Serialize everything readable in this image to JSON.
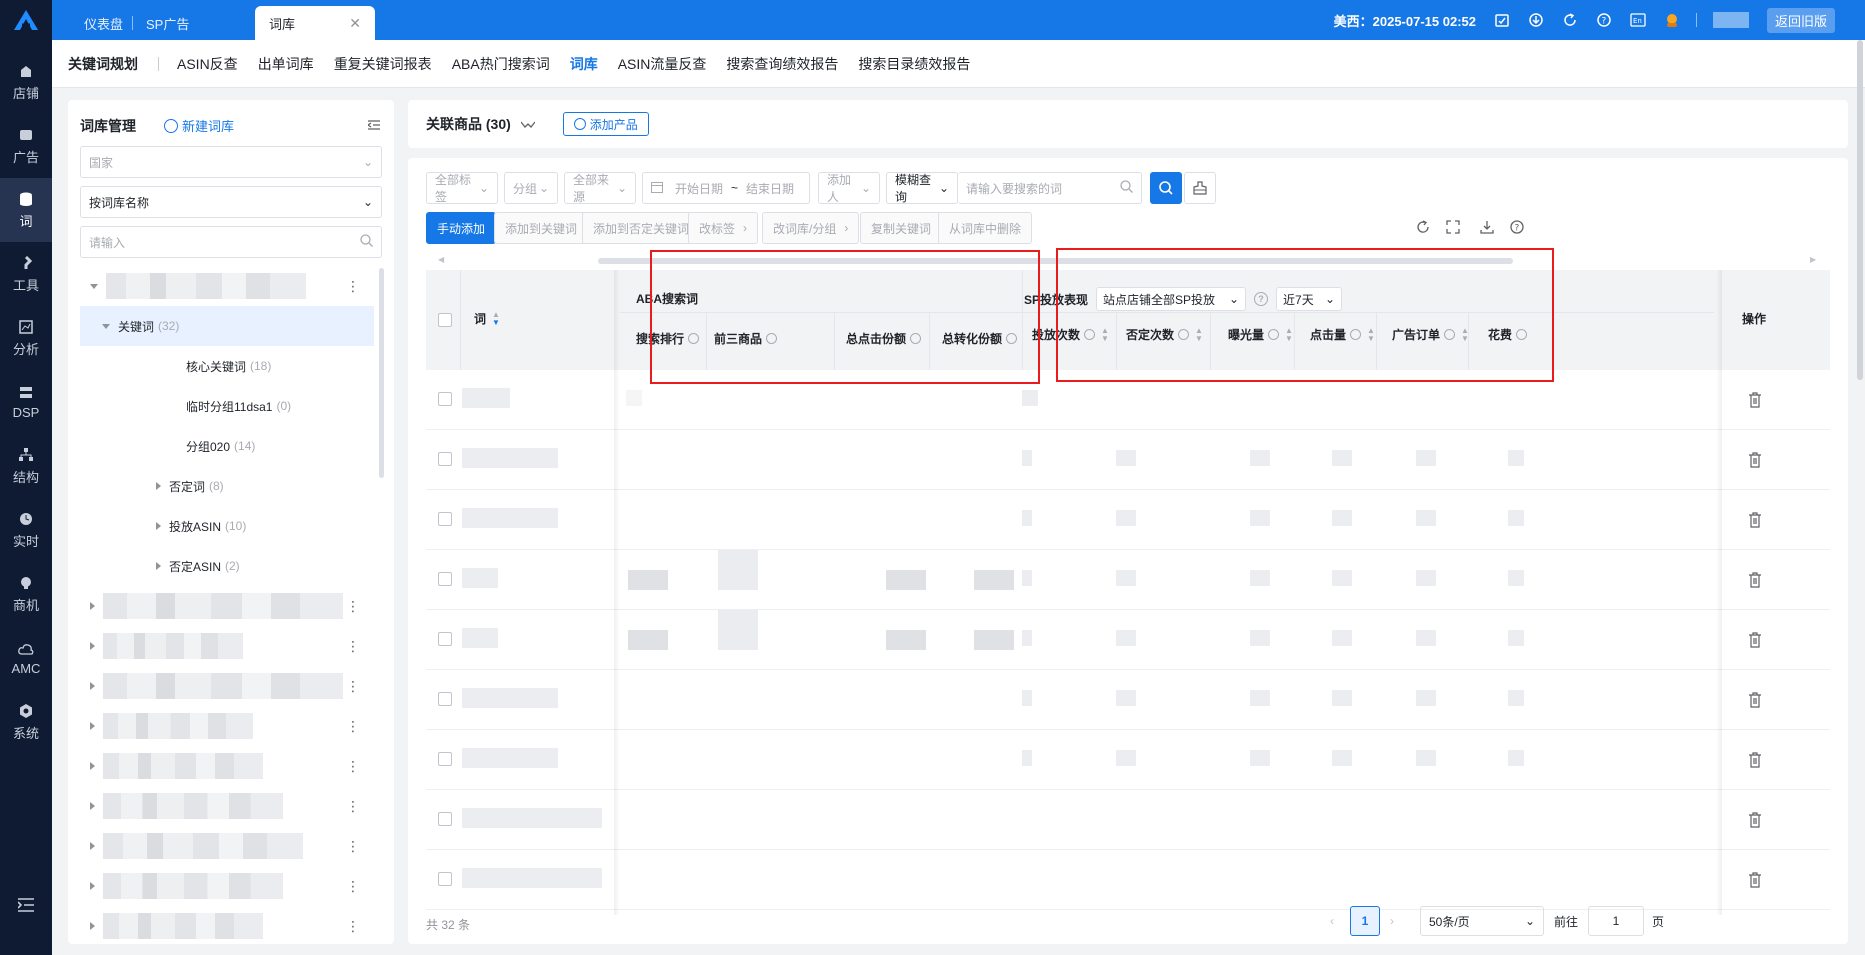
{
  "topbar": {
    "tabs": [
      "仪表盘",
      "SP广告",
      "词库"
    ],
    "datetime": "美西：2025-07-15 02:52",
    "lang_badge": "En",
    "old_version": "返回旧版"
  },
  "leftnav": {
    "items": [
      "店铺",
      "广告",
      "词",
      "工具",
      "分析",
      "DSP",
      "结构",
      "实时",
      "商机",
      "AMC",
      "系统"
    ]
  },
  "subnav": {
    "brand": "关键词规划",
    "items": [
      "ASIN反查",
      "出单词库",
      "重复关键词报表",
      "ABA热门搜索词",
      "词库",
      "ASIN流量反查",
      "搜索查询绩效报告",
      "搜索目录绩效报告"
    ]
  },
  "library": {
    "title": "词库管理",
    "new_label": "新建词库",
    "country_placeholder": "国家",
    "search_by": "按词库名称",
    "search_placeholder": "请输入",
    "tree": [
      {
        "label": "关键词",
        "count": "(32)"
      },
      {
        "label": "核心关键词",
        "count": "(18)"
      },
      {
        "label": "临时分组11dsa1",
        "count": "(0)"
      },
      {
        "label": "分组020",
        "count": "(14)"
      },
      {
        "label": "否定词",
        "count": "(8)"
      },
      {
        "label": "投放ASIN",
        "count": "(10)"
      },
      {
        "label": "否定ASIN",
        "count": "(2)"
      }
    ]
  },
  "main": {
    "title": "关联商品 (30)",
    "add_product": "添加产品",
    "filters": {
      "tags": "全部标签",
      "group": "分组",
      "source": "全部来源",
      "start_date": "开始日期",
      "range_sep": "~",
      "end_date": "结束日期",
      "adder": "添加人",
      "match": "模糊查询",
      "keyword_placeholder": "请输入要搜索的词"
    },
    "actions": [
      "手动添加",
      "添加到关键词",
      "添加到否定关键词",
      "改标签",
      "改词库/分组",
      "复制关键词",
      "从词库中删除"
    ],
    "table": {
      "col_word": "词",
      "group_aba": "ABA搜索词",
      "aba_cols": [
        "搜索排行",
        "前三商品",
        "总点击份额",
        "总转化份额"
      ],
      "group_sp": "SP投放表现",
      "sp_scope": "站点店铺全部SP投放",
      "sp_period": "近7天",
      "sp_cols": [
        "投放次数",
        "否定次数",
        "曝光量",
        "点击量",
        "广告订单",
        "花费"
      ],
      "col_ops": "操作"
    },
    "pagination": {
      "total": "共 32 条",
      "current": "1",
      "page_size": "50条/页",
      "goto_label": "前往",
      "goto_value": "1",
      "page_unit": "页"
    }
  },
  "colors": {
    "primary": "#1677e6",
    "nav_bg": "#0f1b33",
    "highlight_box": "#e81c1c"
  }
}
